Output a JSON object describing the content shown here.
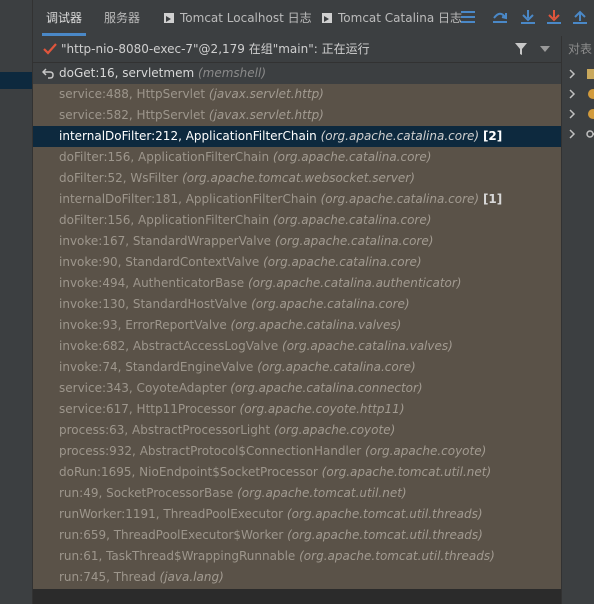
{
  "tabs": [
    {
      "label": "调试器",
      "active": true
    },
    {
      "label": "服务器",
      "active": false
    },
    {
      "label": "Tomcat Localhost 日志",
      "active": false,
      "icon": "tomcat-icon"
    },
    {
      "label": "Tomcat Catalina 日志",
      "active": false,
      "icon": "tomcat-icon"
    }
  ],
  "toolbar_icons": [
    "menu-icon",
    "step-over-icon",
    "step-into-icon",
    "force-step-into-icon",
    "step-out-icon"
  ],
  "thread": {
    "label": "\"http-nio-8080-exec-7\"@2,179 在组\"main\": 正在运行",
    "status_icon": "checkmark-icon"
  },
  "right_panel": {
    "header": "对表"
  },
  "frames": [
    {
      "method": "doGet:16, servletmem",
      "pkg": "(memshell)",
      "state": "current"
    },
    {
      "method": "service:488, HttpServlet",
      "pkg": "(javax.servlet.http)",
      "state": "normal"
    },
    {
      "method": "service:582, HttpServlet",
      "pkg": "(javax.servlet.http)",
      "state": "normal"
    },
    {
      "method": "internalDoFilter:212, ApplicationFilterChain",
      "pkg": "(org.apache.catalina.core)",
      "tag": "[2]",
      "state": "selected"
    },
    {
      "method": "doFilter:156, ApplicationFilterChain",
      "pkg": "(org.apache.catalina.core)",
      "state": "normal"
    },
    {
      "method": "doFilter:52, WsFilter",
      "pkg": "(org.apache.tomcat.websocket.server)",
      "state": "normal"
    },
    {
      "method": "internalDoFilter:181, ApplicationFilterChain",
      "pkg": "(org.apache.catalina.core)",
      "tag": "[1]",
      "state": "normal"
    },
    {
      "method": "doFilter:156, ApplicationFilterChain",
      "pkg": "(org.apache.catalina.core)",
      "state": "normal"
    },
    {
      "method": "invoke:167, StandardWrapperValve",
      "pkg": "(org.apache.catalina.core)",
      "state": "normal"
    },
    {
      "method": "invoke:90, StandardContextValve",
      "pkg": "(org.apache.catalina.core)",
      "state": "normal"
    },
    {
      "method": "invoke:494, AuthenticatorBase",
      "pkg": "(org.apache.catalina.authenticator)",
      "state": "normal"
    },
    {
      "method": "invoke:130, StandardHostValve",
      "pkg": "(org.apache.catalina.core)",
      "state": "normal"
    },
    {
      "method": "invoke:93, ErrorReportValve",
      "pkg": "(org.apache.catalina.valves)",
      "state": "normal"
    },
    {
      "method": "invoke:682, AbstractAccessLogValve",
      "pkg": "(org.apache.catalina.valves)",
      "state": "normal"
    },
    {
      "method": "invoke:74, StandardEngineValve",
      "pkg": "(org.apache.catalina.core)",
      "state": "normal"
    },
    {
      "method": "service:343, CoyoteAdapter",
      "pkg": "(org.apache.catalina.connector)",
      "state": "normal"
    },
    {
      "method": "service:617, Http11Processor",
      "pkg": "(org.apache.coyote.http11)",
      "state": "normal"
    },
    {
      "method": "process:63, AbstractProcessorLight",
      "pkg": "(org.apache.coyote)",
      "state": "normal"
    },
    {
      "method": "process:932, AbstractProtocol$ConnectionHandler",
      "pkg": "(org.apache.coyote)",
      "state": "normal"
    },
    {
      "method": "doRun:1695, NioEndpoint$SocketProcessor",
      "pkg": "(org.apache.tomcat.util.net)",
      "state": "normal"
    },
    {
      "method": "run:49, SocketProcessorBase",
      "pkg": "(org.apache.tomcat.util.net)",
      "state": "normal"
    },
    {
      "method": "runWorker:1191, ThreadPoolExecutor",
      "pkg": "(org.apache.tomcat.util.threads)",
      "state": "normal"
    },
    {
      "method": "run:659, ThreadPoolExecutor$Worker",
      "pkg": "(org.apache.tomcat.util.threads)",
      "state": "normal"
    },
    {
      "method": "run:61, TaskThread$WrappingRunnable",
      "pkg": "(org.apache.tomcat.util.threads)",
      "state": "normal"
    },
    {
      "method": "run:745, Thread",
      "pkg": "(java.lang)",
      "state": "normal"
    }
  ],
  "colors": {
    "accent": "#4a88c7",
    "check": "#e0553c",
    "frames_bg": "#5a5248",
    "selected_bg": "#0d293e"
  }
}
